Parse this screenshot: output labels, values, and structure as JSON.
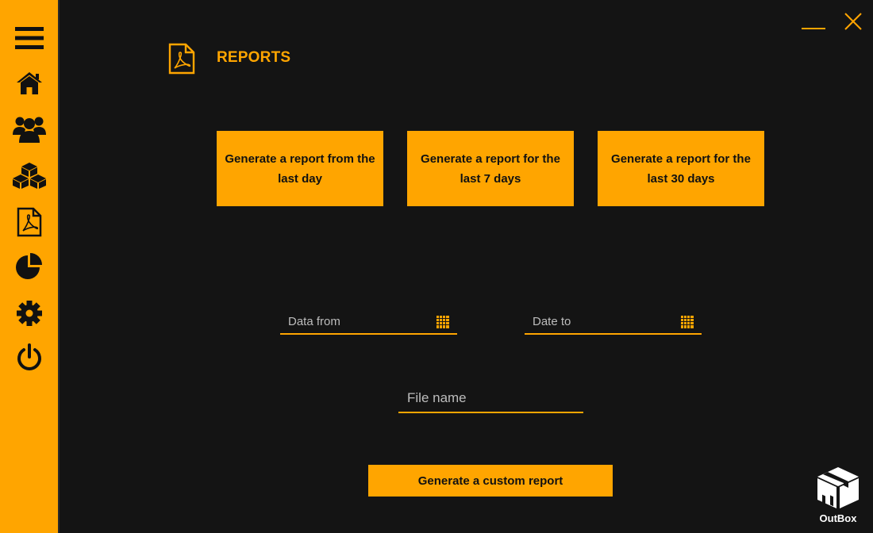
{
  "colors": {
    "accent": "#FFA500",
    "background": "#141414",
    "button_text": "#111111"
  },
  "window": {
    "minimize_icon": "minimize-icon",
    "close_icon": "close-icon"
  },
  "sidebar": {
    "items": [
      {
        "name": "menu",
        "icon": "hamburger-menu-icon"
      },
      {
        "name": "home",
        "icon": "home-icon"
      },
      {
        "name": "users",
        "icon": "users-group-icon"
      },
      {
        "name": "products",
        "icon": "boxes-icon"
      },
      {
        "name": "reports",
        "icon": "pdf-file-icon"
      },
      {
        "name": "statistics",
        "icon": "pie-chart-icon"
      },
      {
        "name": "settings",
        "icon": "gear-icon"
      },
      {
        "name": "logout",
        "icon": "power-icon"
      }
    ]
  },
  "page": {
    "title": "REPORTS",
    "title_icon": "pdf-file-icon"
  },
  "quick_reports": {
    "last_day": "Generate a report from the last day",
    "last_7_days": "Generate a report for the last 7 days",
    "last_30_days": "Generate a report for the last 30 days"
  },
  "custom": {
    "date_from_placeholder": "Data from",
    "date_to_placeholder": "Date to",
    "file_name_placeholder": "File name",
    "calendar_icon": "calendar-icon",
    "generate_label": "Generate a custom report"
  },
  "brand": {
    "name": "OutBox",
    "logo_icon": "box-logo-icon"
  }
}
